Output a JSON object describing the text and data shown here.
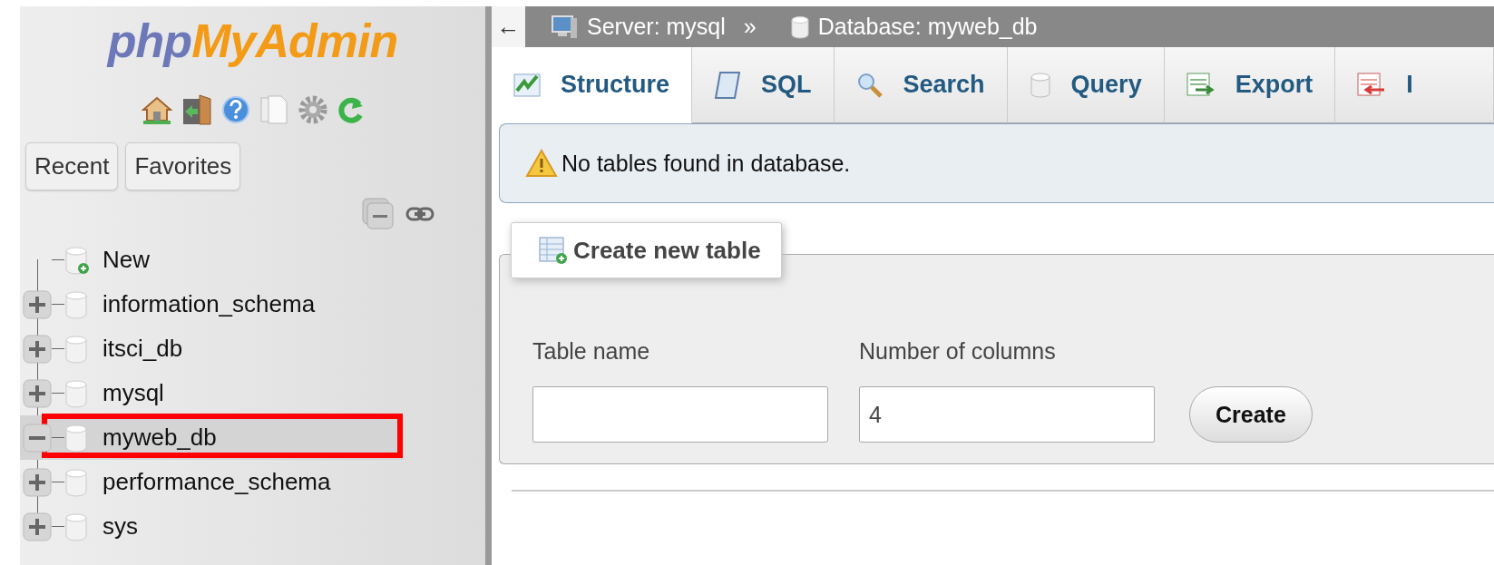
{
  "sidebar": {
    "logo": {
      "part_1": "php",
      "part_2": "MyAdmin"
    },
    "tabs": [
      {
        "label": "Recent"
      },
      {
        "label": "Favorites"
      }
    ],
    "tree": [
      {
        "label": "New",
        "kind": "new"
      },
      {
        "label": "information_schema",
        "kind": "database",
        "expanded": false,
        "selected": false,
        "outlined": false
      },
      {
        "label": "itsci_db",
        "kind": "database",
        "expanded": false,
        "selected": false,
        "outlined": false
      },
      {
        "label": "mysql",
        "kind": "database",
        "expanded": false,
        "selected": false,
        "outlined": false
      },
      {
        "label": "myweb_db",
        "kind": "database",
        "expanded": true,
        "selected": true,
        "outlined": true
      },
      {
        "label": "performance_schema",
        "kind": "database",
        "expanded": false,
        "selected": false,
        "outlined": false
      },
      {
        "label": "sys",
        "kind": "database",
        "expanded": false,
        "selected": false,
        "outlined": false
      }
    ]
  },
  "breadcrumb": {
    "back": "←",
    "server": "Server: mysql",
    "separator": "»",
    "database": "Database: myweb_db"
  },
  "tabs": [
    {
      "label": "Structure",
      "kind": "structure",
      "selected": true
    },
    {
      "label": "SQL",
      "kind": "sql",
      "selected": false
    },
    {
      "label": "Search",
      "kind": "search",
      "selected": false
    },
    {
      "label": "Query",
      "kind": "query",
      "selected": false
    },
    {
      "label": "Export",
      "kind": "export",
      "selected": false
    },
    {
      "label": "I",
      "kind": "import",
      "selected": false
    }
  ],
  "notice": "No tables found in database.",
  "create_table": {
    "legend": "Create new table",
    "table_name_label": "Table name",
    "columns_label": "Number of columns",
    "columns_value": "4",
    "button": "Create"
  }
}
